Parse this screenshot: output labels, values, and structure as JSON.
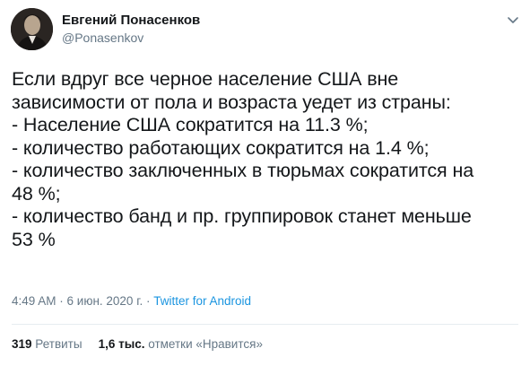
{
  "author": {
    "name": "Евгений Понасенков",
    "handle": "@Ponasenkov"
  },
  "icons": {
    "more": "chevron-down-icon",
    "avatar": "user-avatar"
  },
  "tweet": {
    "lines": [
      "Если вдруг все черное население США вне",
      "зависимости от пола и возраста уедет из страны:",
      "- Население США сократится на 11.3 %;",
      "- количество работающих сократится на 1.4 %;",
      "- количество заключенных в тюрьмах сократится на",
      "48 %;",
      "- количество банд и пр. группировок станет меньше",
      "53 %"
    ]
  },
  "meta": {
    "time": "4:49 AM",
    "sep1": " · ",
    "date": "6 июн. 2020 г.",
    "sep2": " · ",
    "source": "Twitter for Android"
  },
  "stats": {
    "retweets_count": "319",
    "retweets_label": "Ретвиты",
    "likes_count": "1,6 тыс.",
    "likes_label": "отметки «Нравится»"
  },
  "colors": {
    "text": "#14171a",
    "secondary": "#657786",
    "link": "#1b95e0",
    "divider": "#e6ecf0"
  }
}
